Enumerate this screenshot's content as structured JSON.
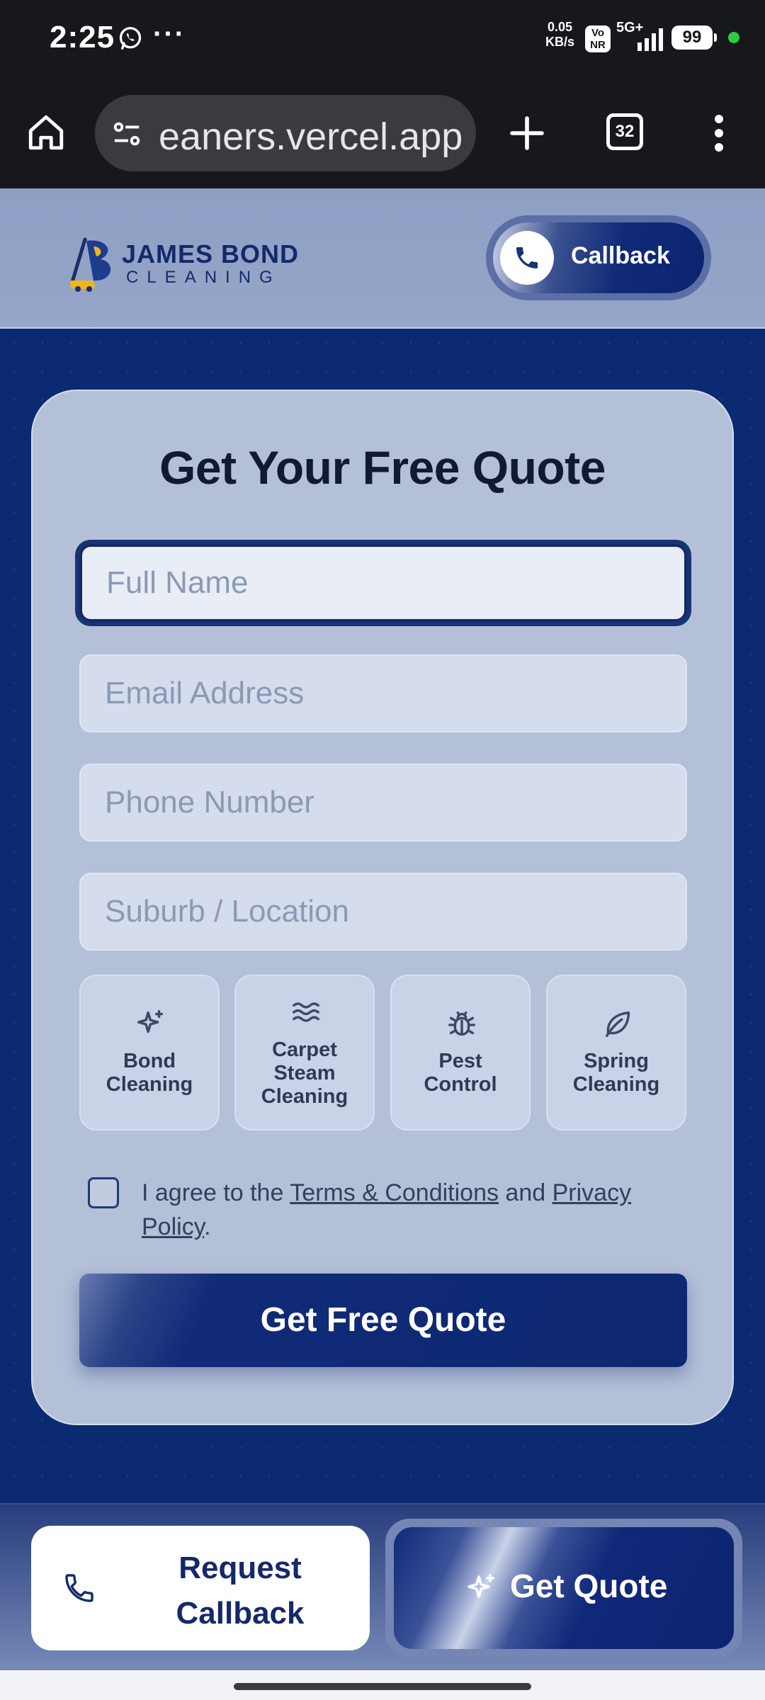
{
  "status_bar": {
    "time": "2:25",
    "network_speed_value": "0.05",
    "network_speed_unit": "KB/s",
    "volte_line1": "Vo",
    "volte_line2": "NR",
    "network_type": "5G+",
    "battery": "99",
    "icons": [
      "whatsapp-icon",
      "more-notifications-icon",
      "signal-icon",
      "battery-icon",
      "active-dot"
    ]
  },
  "browser": {
    "url": "eaners.vercel.app",
    "tab_count": "32",
    "icons": [
      "home-icon",
      "site-info-icon",
      "plus-icon",
      "tab-switcher-icon",
      "kebab-menu-icon"
    ]
  },
  "header": {
    "logo_line1": "JAMES BOND",
    "logo_line2": "CLEANING",
    "callback_label": "Callback",
    "icons": [
      "logo-icon",
      "phone-icon"
    ]
  },
  "form": {
    "title": "Get Your Free Quote",
    "name_placeholder": "Full Name",
    "email_placeholder": "Email Address",
    "phone_placeholder": "Phone Number",
    "suburb_placeholder": "Suburb / Location",
    "services": [
      {
        "line1": "Bond",
        "line2": "Cleaning",
        "icon": "sparkle-icon"
      },
      {
        "line1": "Carpet",
        "line2": "Steam",
        "line3": "Cleaning",
        "icon": "waves-icon"
      },
      {
        "line1": "Pest",
        "line2": "Control",
        "icon": "bug-icon"
      },
      {
        "line1": "Spring",
        "line2": "Cleaning",
        "icon": "leaf-icon"
      }
    ],
    "agree_prefix": "I agree to the ",
    "terms_link": "Terms & Conditions",
    "agree_and": " and ",
    "privacy_link": "Privacy Policy",
    "agree_suffix": ".",
    "submit_label": "Get Free Quote"
  },
  "bottom_bar": {
    "request_line1": "Request",
    "request_line2": "Callback",
    "quote_label": "Get Quote",
    "icons": [
      "phone-icon",
      "sparkle-icon"
    ]
  },
  "colors": {
    "brand_navy": "#0b2a72",
    "card_bg": "#b4c0d8",
    "header_bg": "#8d9fc4",
    "text_dark": "#111a33"
  }
}
